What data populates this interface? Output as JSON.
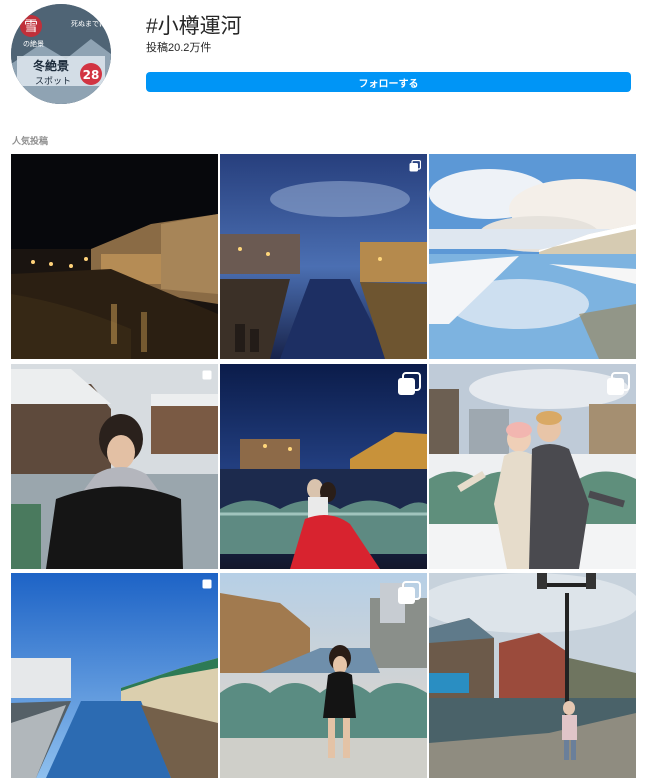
{
  "hashtag": {
    "title": "#小樽運河",
    "post_count": "投稿20.2万件",
    "follow_label": "フォローする",
    "avatar_text": {
      "kanji": "雪",
      "small": "の絶景",
      "right": "死ぬまでに見たい",
      "main1": "冬絶景",
      "main2": "スポット",
      "number": "28"
    }
  },
  "section": {
    "label": "人気投稿"
  },
  "colors": {
    "accent": "#0095f6",
    "text": "#262626",
    "muted": "#8e8e8e"
  },
  "posts": [
    {
      "id": "post-1",
      "scene": "canal-night-warehouses",
      "multiple": false
    },
    {
      "id": "post-2",
      "scene": "canal-dusk-blue",
      "multiple": true,
      "icon": "carousel-icon"
    },
    {
      "id": "post-3",
      "scene": "canal-winter-reflection",
      "multiple": false
    },
    {
      "id": "post-4",
      "scene": "man-in-snow",
      "multiple": true,
      "icon": "carousel-icon"
    },
    {
      "id": "post-5",
      "scene": "couple-night-red-dress",
      "multiple": true,
      "icon": "carousel-icon"
    },
    {
      "id": "post-6",
      "scene": "couple-snow-bridge",
      "multiple": true,
      "icon": "carousel-icon"
    },
    {
      "id": "post-7",
      "scene": "canal-clear-sky",
      "multiple": true,
      "icon": "carousel-icon"
    },
    {
      "id": "post-8",
      "scene": "woman-on-bridge",
      "multiple": true,
      "icon": "carousel-icon"
    },
    {
      "id": "post-9",
      "scene": "lamp-post-canal",
      "multiple": false
    }
  ]
}
